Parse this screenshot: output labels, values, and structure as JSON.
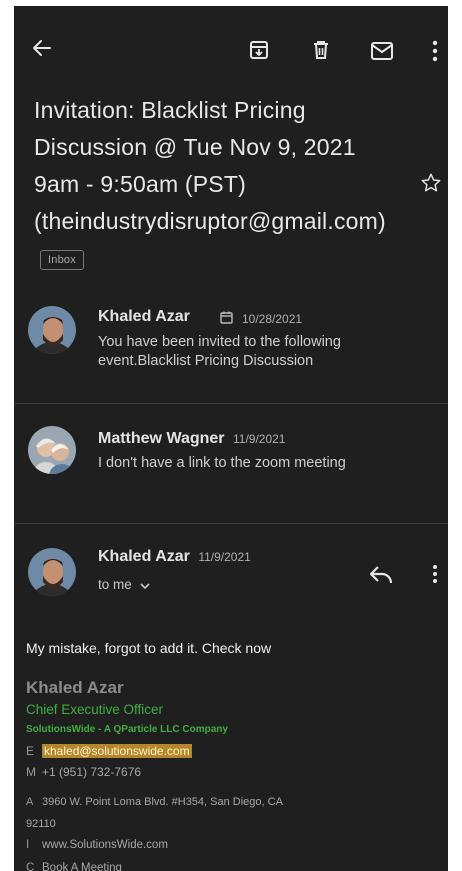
{
  "subject": "Invitation: Blacklist Pricing Discussion @ Tue Nov 9, 2021 9am - 9:50am (PST) (theindustrydisruptor@gmail.com)",
  "label_chip": "Inbox",
  "messages": [
    {
      "sender": "Khaled Azar",
      "date": "10/28/2021",
      "snippet": "You have been invited to the following event.Blacklist Pricing Discussion"
    },
    {
      "sender": "Matthew Wagner",
      "date": "11/9/2021",
      "snippet": "I don't have a link to the zoom meeting"
    }
  ],
  "open_message": {
    "sender": "Khaled Azar",
    "date": "11/9/2021",
    "recipient": "to me",
    "body": "My mistake, forgot to add it. Check now",
    "signature": {
      "name": "Khaled Azar",
      "title": "Chief Executive Officer",
      "company": "SolutionsWide - A QParticle LLC Company",
      "email_label": "E",
      "email": "khaled@solutionswide.com",
      "phone_label": "M",
      "phone": "+1 (951) 732-7676",
      "address_label": "A",
      "address_line1": "3960 W. Point Loma Blvd. #H354, San Diego, CA",
      "address_line2": "92110",
      "web_label": "I",
      "web": "www.SolutionsWide.com",
      "extra_label": "C",
      "extra": "Book A Meeting"
    }
  },
  "colors": {
    "background": "#1f1f1f",
    "signature_green": "#3fae3f",
    "email_highlight": "#b5862c"
  },
  "icons": [
    "back-arrow-icon",
    "archive-icon",
    "delete-icon",
    "mail-icon",
    "more-vert-icon",
    "star-icon",
    "calendar-icon",
    "reply-icon",
    "chevron-down-icon"
  ]
}
